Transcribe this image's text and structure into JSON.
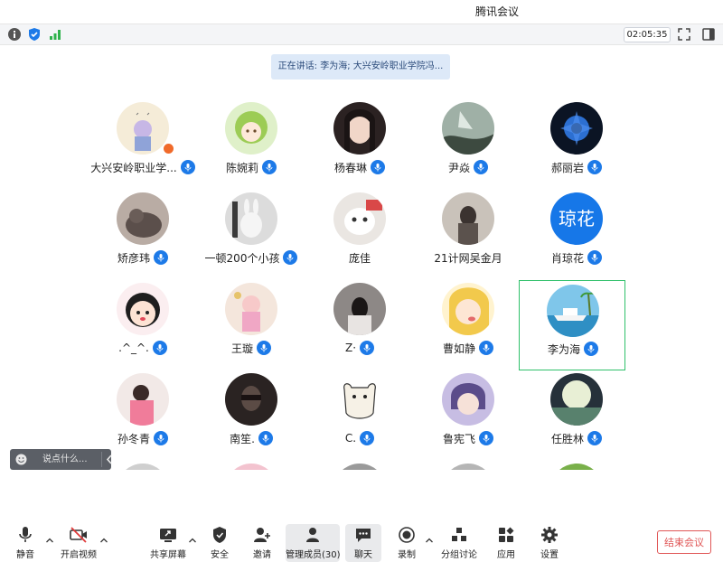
{
  "window": {
    "title": "腾讯会议"
  },
  "infobar": {
    "timer": "02:05:35"
  },
  "speaker": {
    "text": "正在讲话: 李为海; 大兴安岭职业学院冯..."
  },
  "colors": {
    "accent": "#1d7ae8",
    "active_border": "#2fc06a",
    "end_button": "#e05656"
  },
  "participants": [
    {
      "name": "大兴安岭职业学...",
      "avatar": "image-avatar"
    },
    {
      "name": "陈婉莉",
      "avatar": "image-avatar"
    },
    {
      "name": "杨春琳",
      "avatar": "image-avatar"
    },
    {
      "name": "尹焱",
      "avatar": "image-avatar"
    },
    {
      "name": "郝丽岩",
      "avatar": "image-avatar"
    },
    {
      "name": "矫彦玮",
      "avatar": "image-avatar"
    },
    {
      "name": "一顿200个小孩",
      "avatar": "image-avatar"
    },
    {
      "name": "庞佳",
      "avatar": "image-avatar"
    },
    {
      "name": "21计网吴金月",
      "avatar": "image-avatar"
    },
    {
      "name": "肖琼花",
      "avatar_text": "琼花"
    },
    {
      "name": ".^_^.",
      "avatar": "image-avatar"
    },
    {
      "name": "王璇",
      "avatar": "image-avatar"
    },
    {
      "name": "Z·",
      "avatar": "image-avatar"
    },
    {
      "name": "曹如静",
      "avatar": "image-avatar"
    },
    {
      "name": "李为海",
      "avatar": "image-avatar"
    },
    {
      "name": "孙冬青",
      "avatar": "image-avatar"
    },
    {
      "name": "南笙.",
      "avatar": "image-avatar"
    },
    {
      "name": "C.",
      "avatar": "image-avatar"
    },
    {
      "name": "鲁宪飞",
      "avatar": "image-avatar"
    },
    {
      "name": "任胜林",
      "avatar": "image-avatar"
    }
  ],
  "chat": {
    "placeholder": "说点什么..."
  },
  "toolbar": {
    "mute": "静音",
    "video": "开启视频",
    "share": "共享屏幕",
    "security": "安全",
    "invite": "邀请",
    "members": "管理成员(30)",
    "chat": "聊天",
    "record": "录制",
    "breakout": "分组讨论",
    "apps": "应用",
    "settings": "设置",
    "end": "结束会议"
  }
}
